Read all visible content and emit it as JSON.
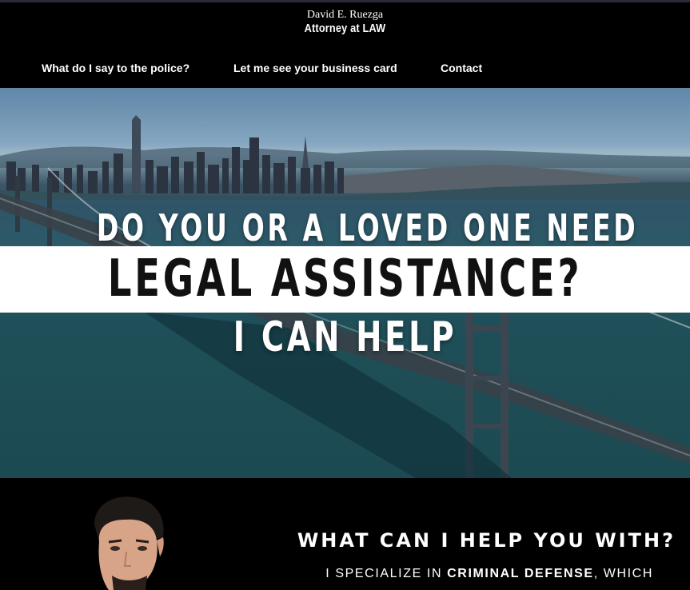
{
  "header": {
    "name": "David E. Ruezga",
    "subtitle": "Attorney at LAW"
  },
  "nav": {
    "items": [
      {
        "label": "What do I say to the police?"
      },
      {
        "label": "Let me see your business card"
      },
      {
        "label": "Contact"
      }
    ]
  },
  "hero": {
    "line1": "DO YOU OR A LOVED ONE NEED",
    "line2": "LEGAL ASSISTANCE?",
    "line3": "I CAN HELP"
  },
  "help": {
    "heading": "WHAT CAN I HELP YOU WITH?",
    "text_prefix": "I SPECIALIZE IN ",
    "text_bold": "CRIMINAL DEFENSE",
    "text_suffix": ", WHICH"
  },
  "colors": {
    "background": "#000000",
    "text": "#ffffff",
    "band": "#ffffff",
    "water": "#1f4f58"
  }
}
